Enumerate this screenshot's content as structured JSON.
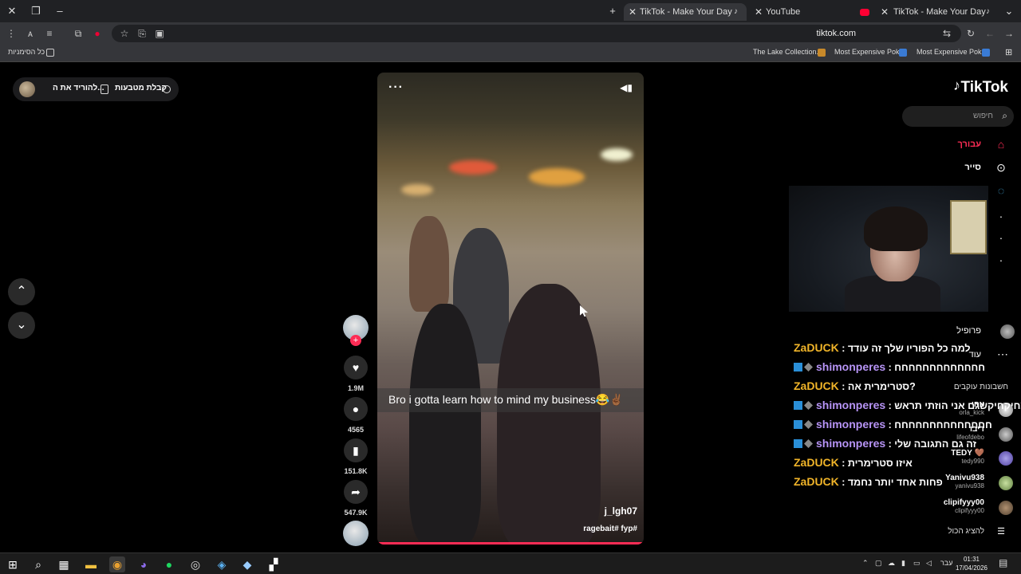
{
  "browser": {
    "tabs": [
      {
        "title": "TikTok - Make Your Day",
        "active": true
      },
      {
        "title": "YouTube",
        "active": false
      },
      {
        "title": "TikTok - Make Your Day",
        "active": false
      }
    ],
    "url": "tiktok.com",
    "bookmarks": {
      "all_bookmarks": "כל הסימניות",
      "items": [
        "The Lake Collection...",
        "Most Expensive Pok...",
        "Most Expensive Pok..."
      ]
    }
  },
  "page": {
    "top_pill": {
      "get_coins": "קבלת מטבעות",
      "download_app": "להוריד את ה..."
    },
    "video": {
      "caption": "Bro i gotta learn how to mind my business😂✌🏾",
      "username": "j_lgh07",
      "hashtags": "ragebait# fyp#"
    },
    "actions": {
      "likes": "1.9M",
      "comments": "4565",
      "saves": "151.8K",
      "shares": "547.9K"
    },
    "sidebar": {
      "logo": "TikTok",
      "search_placeholder": "חיפוש",
      "nav": {
        "for_you": "עבורך",
        "explore": "סייר",
        "profile": "פרופיל",
        "more": "עוד"
      },
      "following_accounts": "חשבונות עוקבים",
      "accounts": [
        {
          "name": "צחי",
          "handle": "orla_kick"
        },
        {
          "name": "דיבו",
          "handle": "lifeofdebo"
        },
        {
          "name": "TEDY 🤎",
          "handle": "tedy990"
        },
        {
          "name": "Yanivu938",
          "handle": "yanivu938"
        },
        {
          "name": "clipifyyy00",
          "handle": "clipifyyy00"
        }
      ],
      "show_all": "להציג הכול"
    },
    "stream_chat": [
      {
        "user": "ZaDUCK",
        "badges": false,
        "msg": "למה כל הפוריו שלך זה עודד"
      },
      {
        "user": "shimonperes",
        "badges": true,
        "msg": "חחחחחחחחחחחחח"
      },
      {
        "user": "ZaDUCK",
        "badges": false,
        "msg": "סטרימרית אה?"
      },
      {
        "user": "shimonperes",
        "badges": true,
        "msg": "צחיקחיקשגם אני הוזתי תראש"
      },
      {
        "user": "shimonperes",
        "badges": true,
        "msg": "חחחחחחחחחחחחחח"
      },
      {
        "user": "shimonperes",
        "badges": true,
        "msg": "זה גם התגובה שלי"
      },
      {
        "user": "ZaDUCK",
        "badges": false,
        "msg": "איזו סטרימרית"
      },
      {
        "user": "ZaDUCK",
        "badges": false,
        "msg": "פחות אחד יותר נחמד"
      }
    ]
  },
  "taskbar": {
    "lang": "עבר",
    "time": "01:31",
    "date": "17/04/2026"
  },
  "colors": {
    "accent": "#fe2c55",
    "chat_gold": "#f0b429",
    "chat_purple": "#b794f6"
  }
}
